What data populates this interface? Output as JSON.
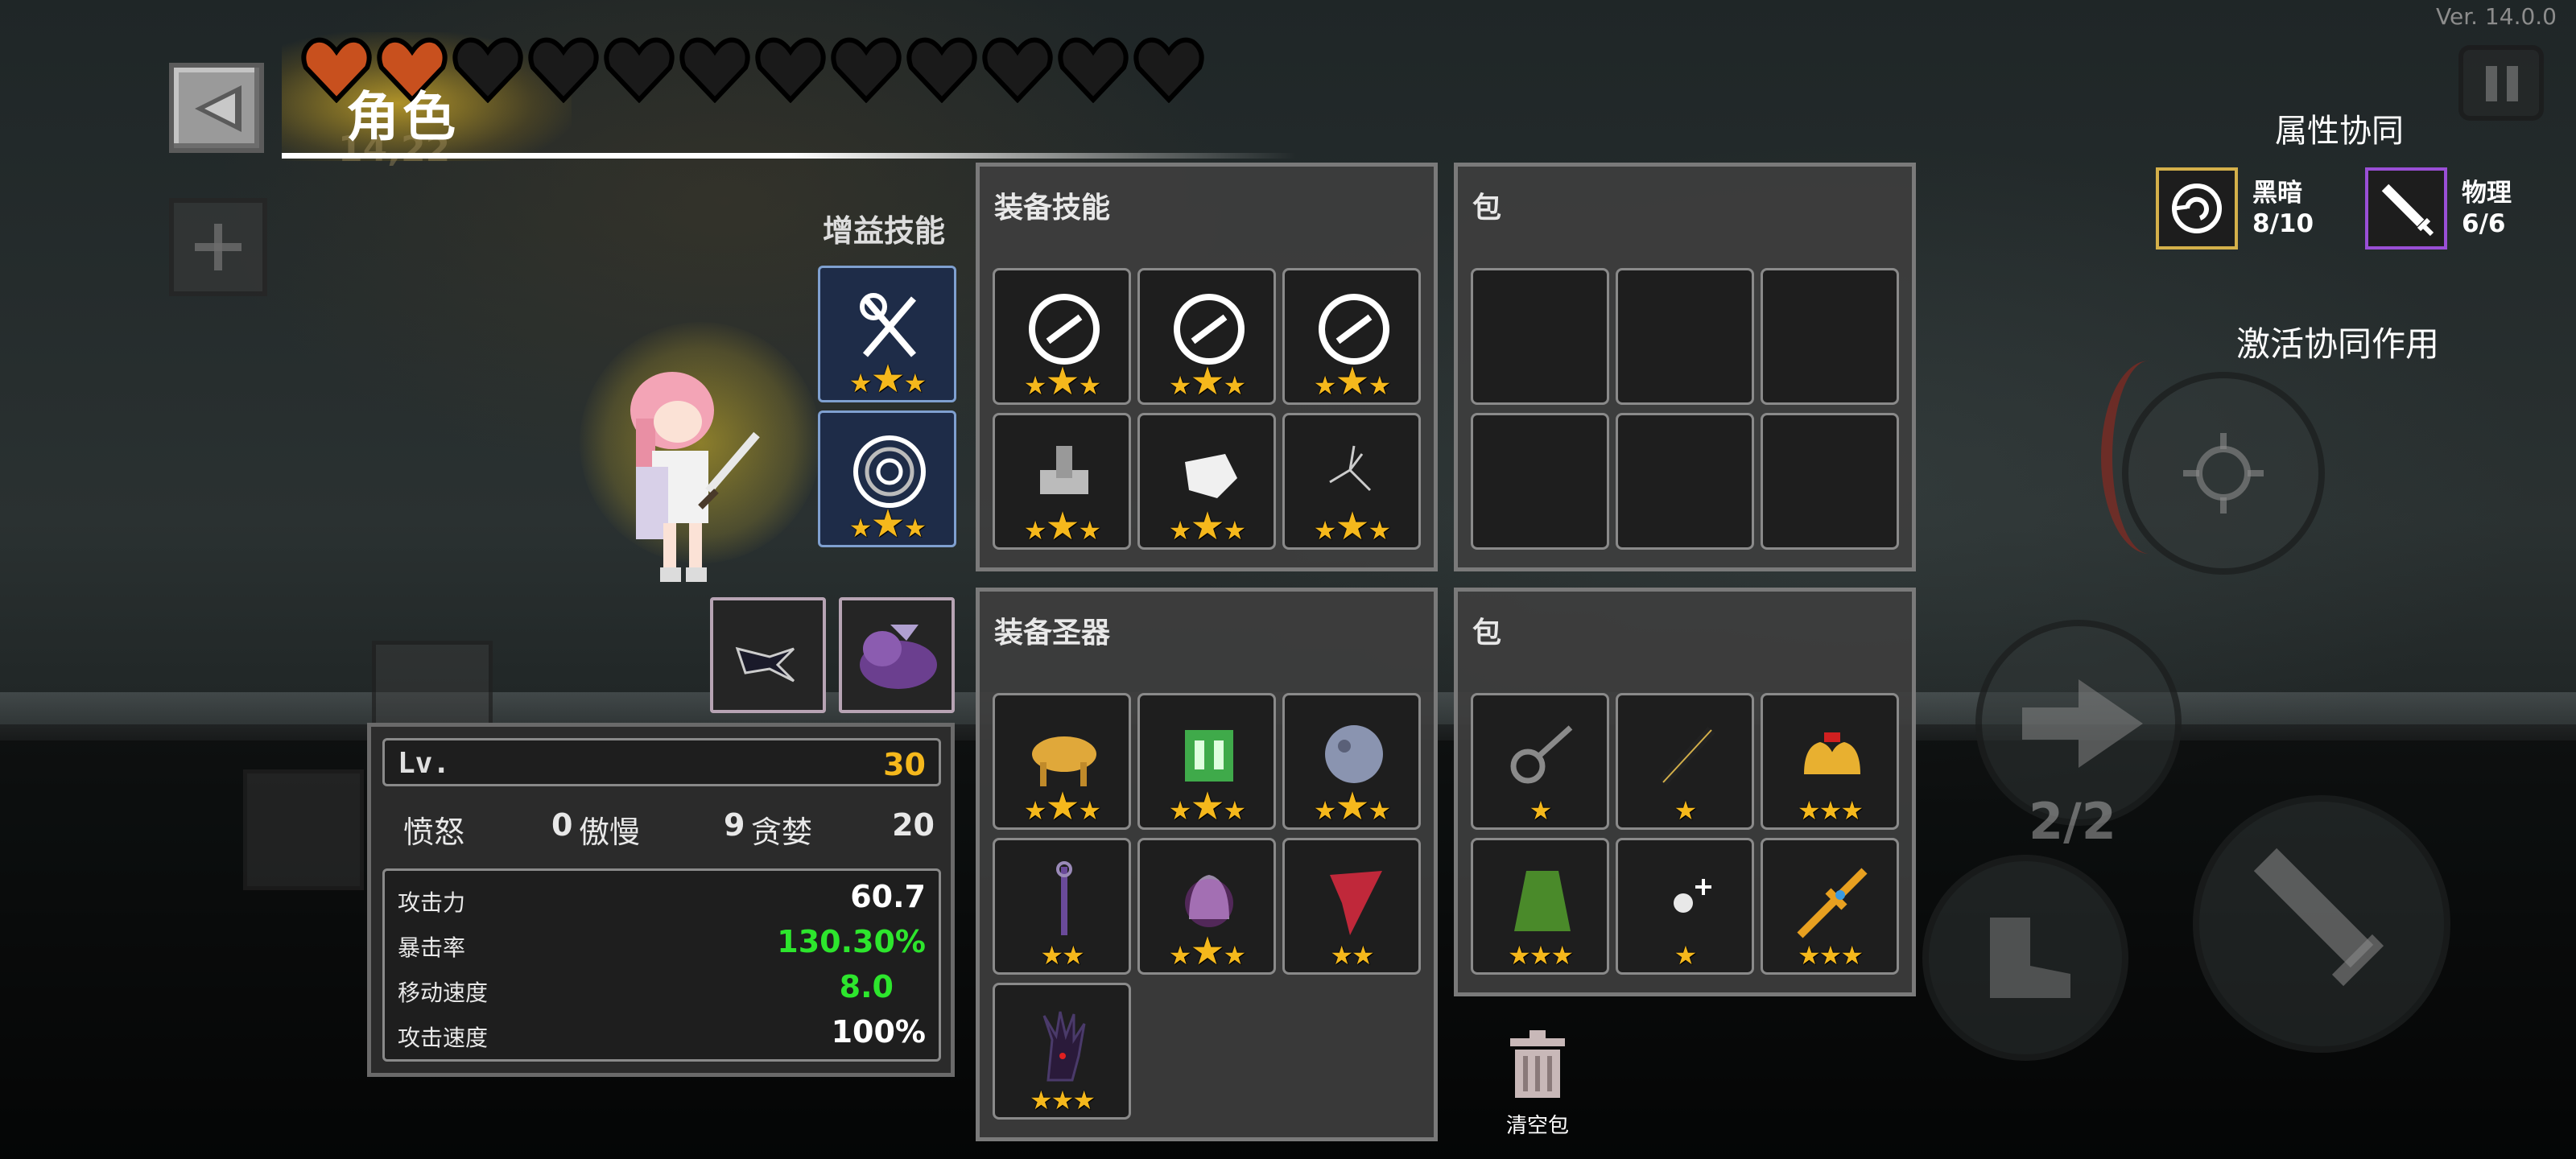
{
  "version": "Ver. 14.0.0",
  "header": {
    "title": "角色",
    "dim_gold": "14,22"
  },
  "hearts": {
    "filled": 2,
    "total": 12,
    "fill_color": "#c8501e",
    "empty_color": "#1a1a1a"
  },
  "synergy": {
    "title": "属性协同",
    "items": [
      {
        "name": "黑暗",
        "count": "8/10",
        "icon": "dark-swirl-icon",
        "border_color": "#d4b04a"
      },
      {
        "name": "物理",
        "count": "6/6",
        "icon": "sword-icon",
        "border_color": "#9a4fd6"
      }
    ],
    "activate_label": "激活协同作用"
  },
  "buff_skills": {
    "label": "增益技能",
    "slots": [
      {
        "icon": "crossed-weapons-icon",
        "stars": 3
      },
      {
        "icon": "vortex-icon",
        "stars": 3
      }
    ]
  },
  "companions": [
    {
      "icon": "bird-pet-icon"
    },
    {
      "icon": "purple-boar-icon"
    }
  ],
  "equip_skills": {
    "title": "装备技能",
    "slots": [
      {
        "icon": "gear-ring-icon",
        "stars": 3
      },
      {
        "icon": "gear-ring-icon",
        "stars": 3
      },
      {
        "icon": "gear-ring-icon",
        "stars": 3
      },
      {
        "icon": "stone-arm-icon",
        "stars": 3
      },
      {
        "icon": "white-glove-icon",
        "stars": 3
      },
      {
        "icon": "crack-icon",
        "stars": 3
      }
    ]
  },
  "skill_bag": {
    "title": "包",
    "slots": 6
  },
  "relics": {
    "title": "装备圣器",
    "slots": [
      {
        "icon": "golden-bull-icon",
        "stars": 3
      },
      {
        "icon": "green-cube-icon",
        "stars": 3
      },
      {
        "icon": "moon-orb-icon",
        "stars": 3
      },
      {
        "icon": "purple-staff-icon",
        "stars": 2
      },
      {
        "icon": "purple-bell-icon",
        "stars": 3
      },
      {
        "icon": "red-cloth-icon",
        "stars": 2
      },
      {
        "icon": "dark-hand-icon",
        "stars": 3
      }
    ]
  },
  "relic_bag": {
    "title": "包",
    "slots": [
      {
        "icon": "key-icon",
        "stars": 1
      },
      {
        "icon": "pen-icon",
        "stars": 1
      },
      {
        "icon": "golden-bells-icon",
        "stars": 3
      },
      {
        "icon": "green-cloak-icon",
        "stars": 3
      },
      {
        "icon": "sparkle-orb-icon",
        "stars": 1
      },
      {
        "icon": "golden-sword-icon",
        "stars": 3
      }
    ]
  },
  "stats": {
    "level_label": "Lv.",
    "level": "30",
    "sins": [
      {
        "label": "愤怒",
        "value": "0"
      },
      {
        "label": "傲慢",
        "value": "9"
      },
      {
        "label": "贪婪",
        "value": "20"
      }
    ],
    "attributes": [
      {
        "label": "攻击力",
        "value": "60.7",
        "color": "#ffffff"
      },
      {
        "label": "暴击率",
        "value": "130.30%",
        "color": "#2de62d"
      },
      {
        "label": "移动速度",
        "value": "8.0",
        "color": "#2de62d"
      },
      {
        "label": "攻击速度",
        "value": "100%",
        "color": "#ffffff"
      }
    ]
  },
  "clear_bag_label": "清空包",
  "controls": {
    "counter": "2/2"
  }
}
